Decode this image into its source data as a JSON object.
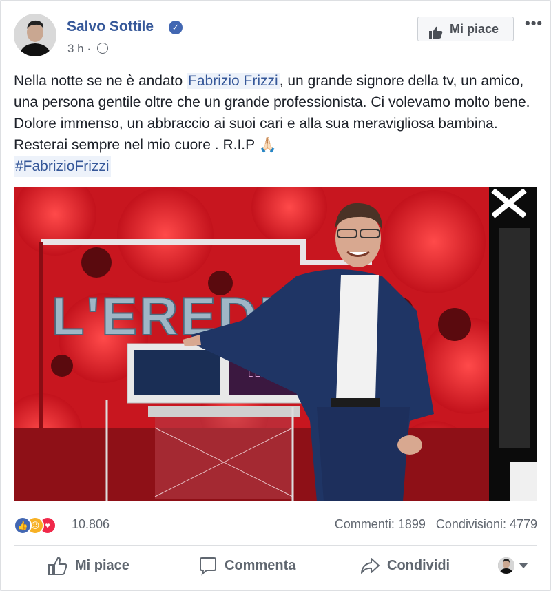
{
  "post": {
    "author": "Salvo Sottile",
    "time": "3 h",
    "like_page_label": "Mi piace",
    "more_label": "•••",
    "text_before": "Nella notte se ne è andato ",
    "mention": "Fabrizio Frizzi",
    "text_after": ", un grande signore della tv, un amico, una persona gentile oltre che un grande professionista. Ci volevamo molto bene. Dolore immenso, un abbraccio ai suoi cari e alla sua meravigliosa bambina. Resterai sempre nel mio cuore . R.I.P 🙏🏻",
    "hashtag": "#FabrizioFrizzi",
    "photo": {
      "set_text": "L'EREDITÀ",
      "screen_text": "L'EREDITÀ",
      "close_glyph": "✕"
    },
    "reactions": {
      "count": "10.806",
      "icons": [
        "like-icon",
        "sad-icon",
        "love-icon"
      ]
    },
    "comments_label": "Commenti: 1899",
    "shares_label": "Condivisioni: 4779",
    "actions": {
      "like": "Mi piace",
      "comment": "Commenta",
      "share": "Condividi"
    }
  },
  "colors": {
    "link": "#365899",
    "like_blue": "#4267b2",
    "love_red": "#f0284a",
    "sad_yellow": "#f7b125",
    "studio_red": "#d41f28"
  }
}
